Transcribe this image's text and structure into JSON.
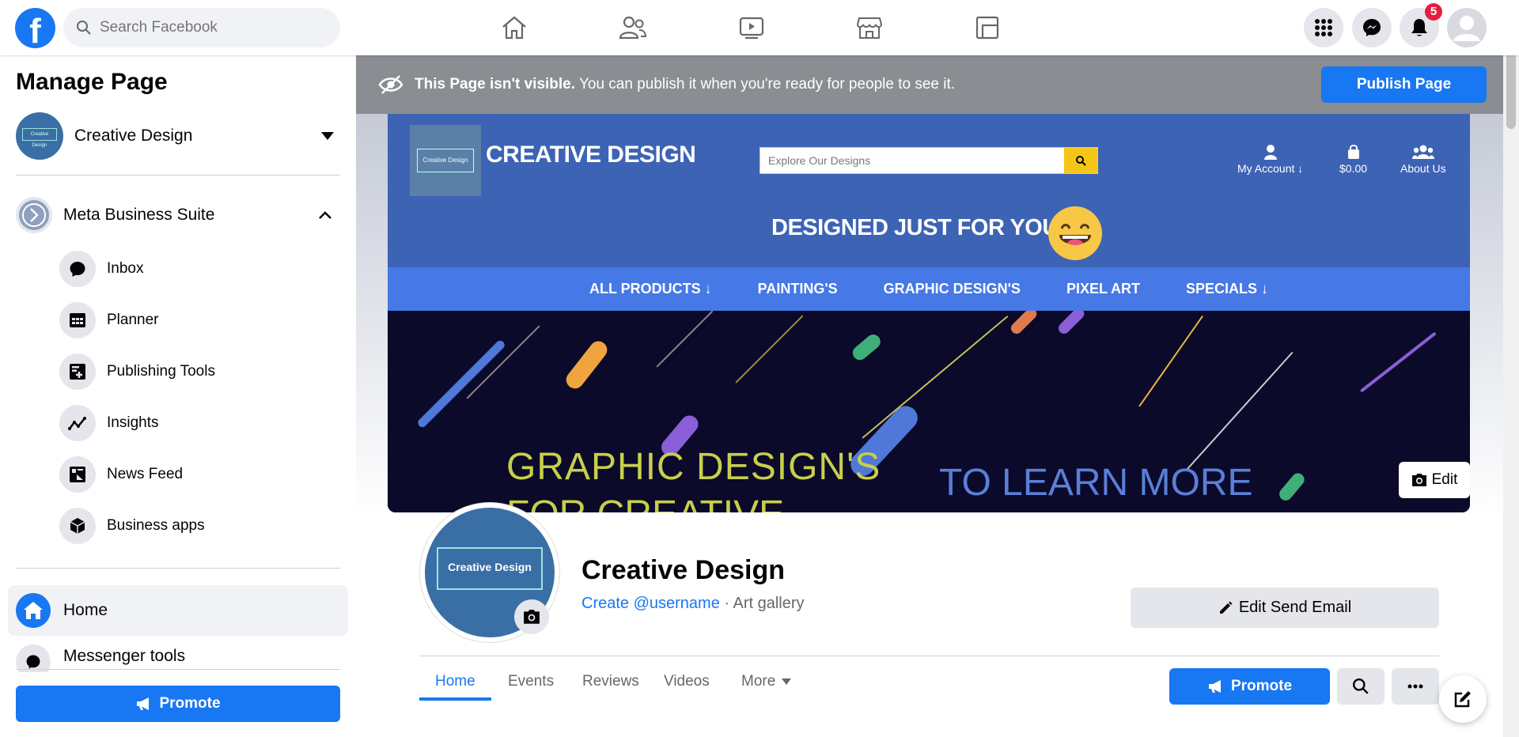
{
  "topbar": {
    "logo_text": "f",
    "search_placeholder": "Search Facebook",
    "nav_icons": [
      "home-icon",
      "friends-icon",
      "watch-icon",
      "marketplace-icon",
      "gaming-icon"
    ],
    "notification_count": "5"
  },
  "sidebar": {
    "title": "Manage Page",
    "page_name": "Creative Design",
    "avatar_text": "Creative Design",
    "business_suite": "Meta Business Suite",
    "items": [
      {
        "label": "Inbox",
        "icon": "chat-bubble-icon"
      },
      {
        "label": "Planner",
        "icon": "calendar-grid-icon"
      },
      {
        "label": "Publishing Tools",
        "icon": "publishing-tools-icon"
      },
      {
        "label": "Insights",
        "icon": "insights-chart-icon"
      },
      {
        "label": "News Feed",
        "icon": "news-feed-icon"
      },
      {
        "label": "Business apps",
        "icon": "cube-icon"
      }
    ],
    "home_label": "Home",
    "messenger_tools_label": "Messenger tools",
    "promote_label": "Promote"
  },
  "banner": {
    "bold_text": "This Page isn't visible.",
    "text": " You can publish it when you're ready for people to see it.",
    "publish_label": "Publish Page"
  },
  "cover": {
    "site_name": "CREATIVE DESIGN",
    "logo_text": "Creative Design",
    "search_placeholder": "Explore Our Designs",
    "account_label": "My Account ↓",
    "cart_label": "$0.00",
    "about_label": "About Us",
    "slogan": "DESIGNED JUST FOR YOU",
    "nav": [
      "ALL PRODUCTS ↓",
      "PAINTING'S",
      "GRAPHIC DESIGN'S",
      "PIXEL ART",
      "SPECIALS ↓"
    ],
    "hero_line1": "GRAPHIC DESIGN'S",
    "hero_line2": "FOR CREATIVE",
    "hero_line3": "TO LEARN MORE",
    "edit_label": "Edit"
  },
  "profile": {
    "avatar_text": "Creative Design",
    "name": "Creative Design",
    "username_link": "Create @username",
    "category": " · Art gallery",
    "edit_email_label": "Edit Send Email"
  },
  "tabs": {
    "items": [
      "Home",
      "Events",
      "Reviews",
      "Videos",
      "More"
    ],
    "active": "Home",
    "promote_label": "Promote"
  },
  "colors": {
    "brand": "#1877f2",
    "banner": "#8a8d91",
    "cover_header": "#3d63b4",
    "cover_nav": "#4678e6",
    "badge": "#e41e3f"
  }
}
